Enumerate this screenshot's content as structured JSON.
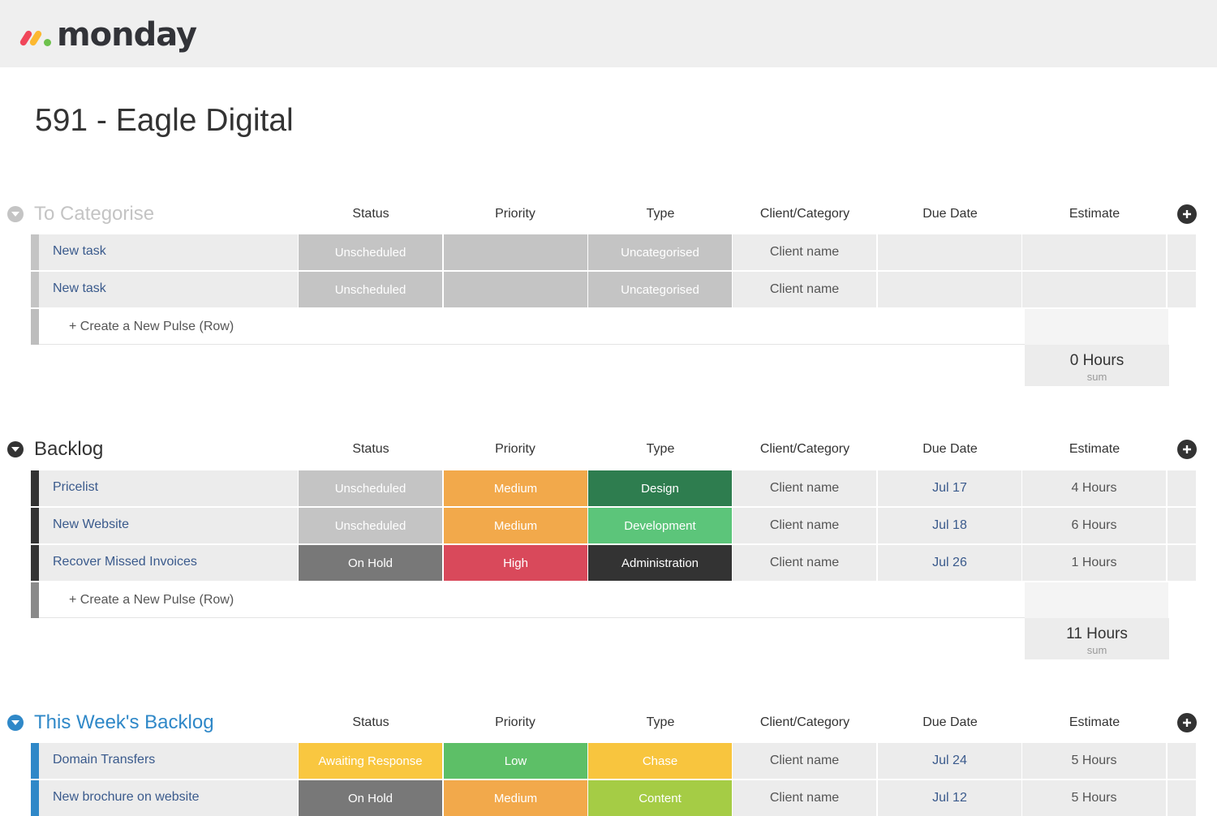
{
  "app": {
    "logo_text": "monday"
  },
  "board": {
    "title": "591 - Eagle Digital"
  },
  "columns": [
    "Status",
    "Priority",
    "Type",
    "Client/Category",
    "Due Date",
    "Estimate"
  ],
  "create_row_label": "+ Create a New Pulse (Row)",
  "colors": {
    "unscheduled": "#c4c4c4",
    "uncategorised": "#c4c4c4",
    "on_hold": "#787878",
    "medium": "#f2a94b",
    "high": "#d9495b",
    "low": "#5dbf67",
    "awaiting_response": "#f9c740",
    "design": "#2e7d4f",
    "development": "#5cc57a",
    "administration": "#333333",
    "chase": "#f8c53e",
    "content": "#a5cc45"
  },
  "groups": [
    {
      "name": "To Categorise",
      "color": "#c4c4c4",
      "rows": [
        {
          "name": "New task",
          "status": "Unscheduled",
          "priority": "",
          "type": "Uncategorised",
          "client": "Client name",
          "due": "",
          "estimate": ""
        },
        {
          "name": "New task",
          "status": "Unscheduled",
          "priority": "",
          "type": "Uncategorised",
          "client": "Client name",
          "due": "",
          "estimate": ""
        }
      ],
      "sum": {
        "value": "0 Hours",
        "label": "sum"
      }
    },
    {
      "name": "Backlog",
      "color": "#333333",
      "rows": [
        {
          "name": "Pricelist",
          "status": "Unscheduled",
          "priority": "Medium",
          "type": "Design",
          "client": "Client name",
          "due": "Jul 17",
          "estimate": "4 Hours"
        },
        {
          "name": "New Website",
          "status": "Unscheduled",
          "priority": "Medium",
          "type": "Development",
          "client": "Client name",
          "due": "Jul 18",
          "estimate": "6 Hours"
        },
        {
          "name": "Recover Missed Invoices",
          "status": "On Hold",
          "priority": "High",
          "type": "Administration",
          "client": "Client name",
          "due": "Jul 26",
          "estimate": "1 Hours"
        }
      ],
      "sum": {
        "value": "11 Hours",
        "label": "sum"
      }
    },
    {
      "name": "This Week's Backlog",
      "color": "#2f88c8",
      "rows": [
        {
          "name": "Domain Transfers",
          "status": "Awaiting Response",
          "priority": "Low",
          "type": "Chase",
          "client": "Client name",
          "due": "Jul 24",
          "estimate": "5 Hours"
        },
        {
          "name": "New brochure on website",
          "status": "On Hold",
          "priority": "Medium",
          "type": "Content",
          "client": "Client name",
          "due": "Jul 12",
          "estimate": "5 Hours"
        }
      ]
    }
  ]
}
